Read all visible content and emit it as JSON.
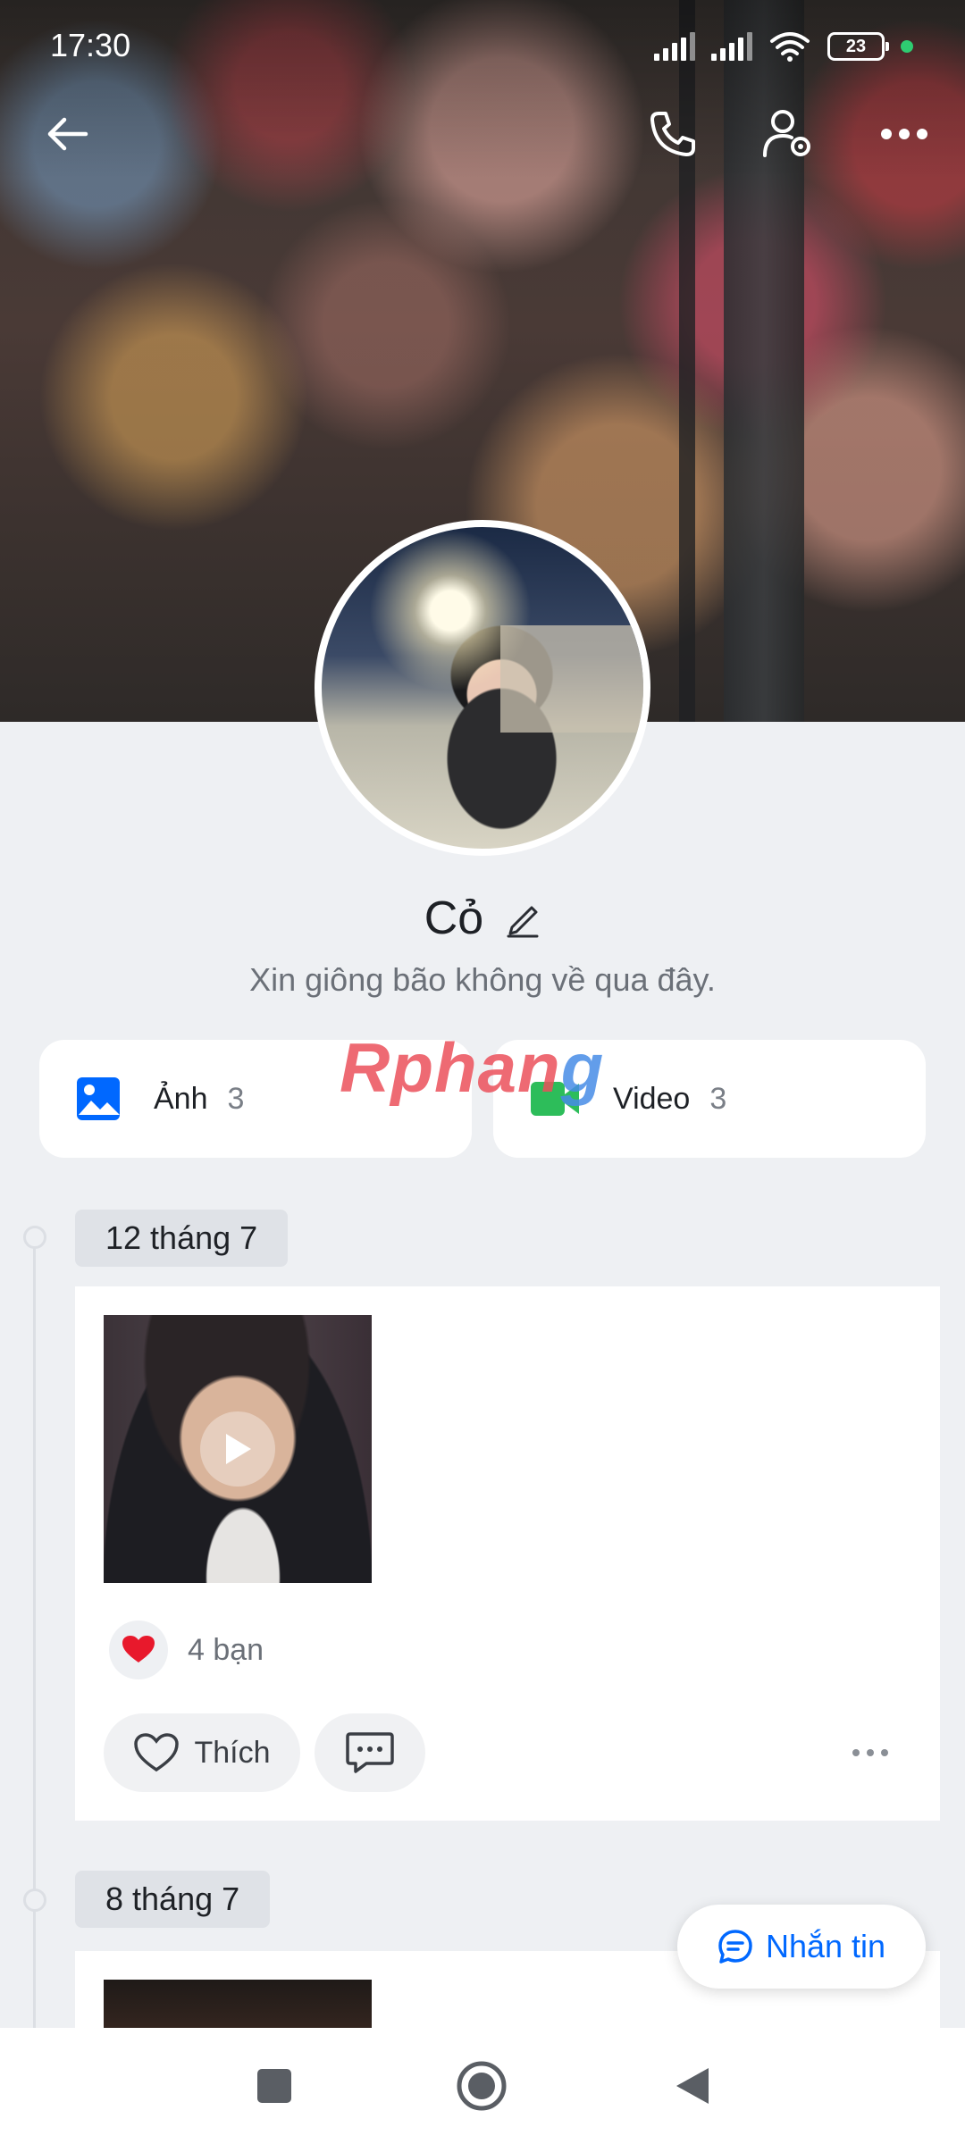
{
  "status_bar": {
    "time": "17:30",
    "battery": "23",
    "icons": [
      "signal-icon",
      "signal-icon",
      "wifi-icon",
      "battery-icon"
    ]
  },
  "header": {
    "back_icon": "arrow-left-icon",
    "call_icon": "phone-icon",
    "settings_icon": "user-settings-icon",
    "more_icon": "more-horizontal-icon"
  },
  "profile": {
    "name": "Cỏ",
    "status": "Xin giông bão không về qua đây."
  },
  "media": {
    "photos": {
      "label": "Ảnh",
      "count": "3"
    },
    "videos": {
      "label": "Video",
      "count": "3"
    }
  },
  "watermark": {
    "part1": "Rphan",
    "part2": "g"
  },
  "timeline": [
    {
      "date": "12 tháng 7",
      "reaction_count": "4 bạn",
      "like_label": "Thích"
    },
    {
      "date": "8 tháng 7"
    }
  ],
  "fab": {
    "label": "Nhắn tin"
  },
  "colors": {
    "accent": "#0068ff",
    "photo_icon": "#0068ff",
    "video_icon": "#2dbd5a",
    "heart": "#e8192c",
    "background": "#eef0f3"
  }
}
